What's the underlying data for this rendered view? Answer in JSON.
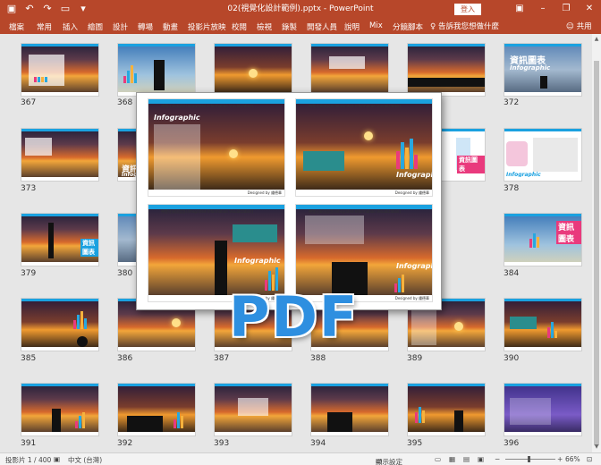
{
  "app": {
    "title": "02(視覺化設計範例).pptx - PowerPoint",
    "login_label": "登入",
    "qat_icons": [
      "save-icon",
      "undo-icon",
      "redo-icon",
      "start-from-beginning-icon",
      "customize-qat-icon"
    ],
    "window_controls": [
      "ribbon-display-options-icon",
      "minimize-icon",
      "restore-icon",
      "close-icon"
    ]
  },
  "ribbon": {
    "tabs": [
      "檔案",
      "常用",
      "插入",
      "繪圖",
      "設計",
      "轉場",
      "動畫",
      "投影片放映",
      "校閱",
      "檢視",
      "錄製",
      "開發人員",
      "說明",
      "Mix",
      "分鏡腳本"
    ],
    "tell_me": "告訴我您想做什麼",
    "share_label": "共用"
  },
  "slides": [
    {
      "num": "367"
    },
    {
      "num": "368"
    },
    {
      "num": ""
    },
    {
      "num": ""
    },
    {
      "num": ""
    },
    {
      "num": "372"
    },
    {
      "num": "373"
    },
    {
      "num": ""
    },
    {
      "num": ""
    },
    {
      "num": ""
    },
    {
      "num": ""
    },
    {
      "num": "378"
    },
    {
      "num": "379"
    },
    {
      "num": "380"
    },
    {
      "num": ""
    },
    {
      "num": ""
    },
    {
      "num": ""
    },
    {
      "num": "384"
    },
    {
      "num": "385"
    },
    {
      "num": "386"
    },
    {
      "num": "387"
    },
    {
      "num": "388"
    },
    {
      "num": "389"
    },
    {
      "num": "390"
    },
    {
      "num": "391"
    },
    {
      "num": "392"
    },
    {
      "num": "393"
    },
    {
      "num": "394"
    },
    {
      "num": "395"
    },
    {
      "num": "396"
    }
  ],
  "thumb_texts": {
    "s372_title": "資訊圖表",
    "s372_sub": "Infographic",
    "s374_title": "資訊圖表",
    "s374_sub": "Infographic",
    "s377_tag": "資訊圖表",
    "s378_sub": "Infographic",
    "s379_tag": "資訊圖表",
    "s384_tag": "資訊圖表"
  },
  "popup": {
    "slides": [
      {
        "caption": "視覺化資訊設計(Integrated Information Visualization)",
        "label": "Infographic",
        "footer": "Designed by 鍾德華"
      },
      {
        "caption": "視覺化資訊設計(Integrated Information Visualization)",
        "label": "Infographic",
        "footer": "Designed by 鍾德華"
      },
      {
        "caption": "視覺化資訊設計(Integrated Information Visualization)",
        "label": "Infographic",
        "footer": "Designed by 鍾德華"
      },
      {
        "caption": "視覺化資訊設計(Integrated Information Visualization)",
        "label": "Infographic",
        "footer": "Designed by 鍾德華"
      }
    ]
  },
  "overlay_text": "PDF",
  "status": {
    "slide_info": "投影片 1 / 400",
    "language": "中文 (台灣)",
    "display_settings": "顯示設定",
    "zoom": "66%"
  },
  "colors": {
    "accent": "#b7472a",
    "pdf_text": "#2e8fe0",
    "slide_header": "#1aa1e0"
  }
}
